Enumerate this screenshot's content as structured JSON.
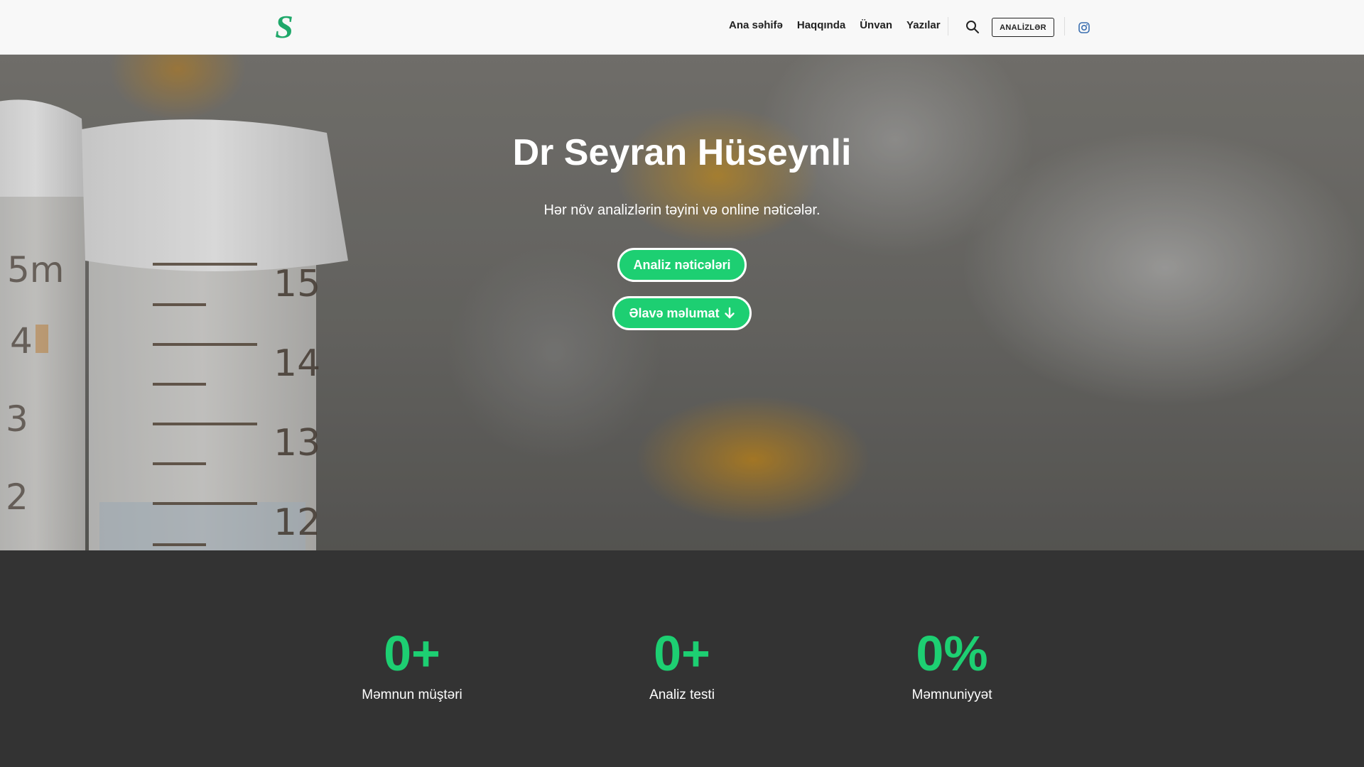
{
  "header": {
    "logo_letter": "S",
    "nav": [
      "Ana səhifə",
      "Haqqında",
      "Ünvan",
      "Yazılar"
    ],
    "cta_label": "ANALİZLƏR"
  },
  "hero": {
    "title": "Dr Seyran Hüseynli",
    "subtitle": "Hər növ analizlərin təyini və online nəticələr.",
    "primary_button": "Analiz nəticələri",
    "secondary_button": "Əlavə məlumat",
    "tube_scale_labels": [
      "15",
      "14",
      "13",
      "12"
    ],
    "left_tube_labels": [
      "5m",
      "4",
      "3",
      "2"
    ]
  },
  "stats": [
    {
      "value": "0+",
      "label": "Məmnun müştəri"
    },
    {
      "value": "0+",
      "label": "Analiz testi"
    },
    {
      "value": "0%",
      "label": "Məmnuniyyət"
    }
  ],
  "colors": {
    "accent": "#1dcf72",
    "logo": "#1fa86a",
    "stats_background": "#333333",
    "header_background": "#f8f8f8"
  },
  "icons": {
    "search": "search-icon",
    "instagram": "instagram-icon",
    "arrow": "arrow-down-icon"
  }
}
